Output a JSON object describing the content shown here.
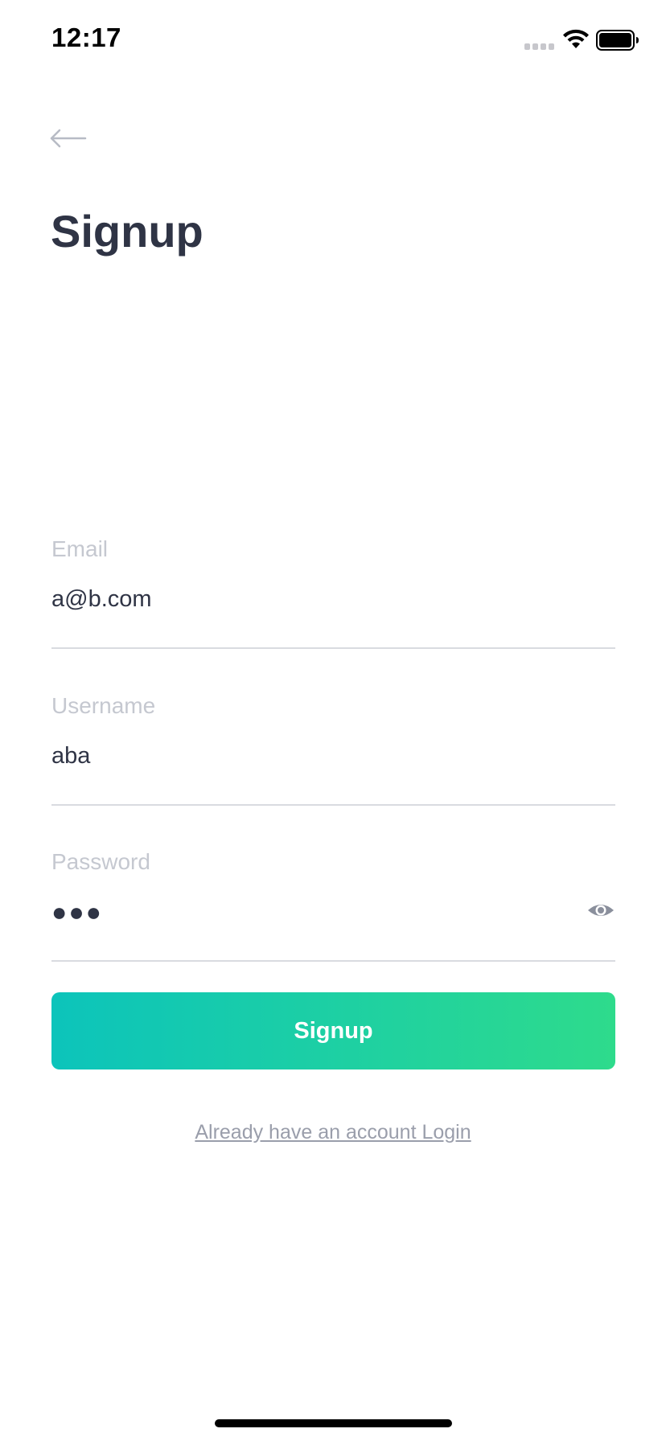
{
  "status_bar": {
    "time": "12:17",
    "icons": [
      "signal-icon",
      "wifi-icon",
      "battery-icon"
    ]
  },
  "header": {
    "back_icon": "back-arrow-icon",
    "title": "Signup"
  },
  "form": {
    "email": {
      "label": "Email",
      "value": "a@b.com"
    },
    "username": {
      "label": "Username",
      "value": "aba"
    },
    "password": {
      "label": "Password",
      "value_masked": "●●●",
      "visibility_icon": "eye-icon"
    }
  },
  "actions": {
    "signup_label": "Signup",
    "login_link": "Already have an account Login"
  },
  "colors": {
    "title_text": "#2f3445",
    "label_text": "#c5c8d0",
    "underline": "#d9dbe0",
    "button_gradient_start": "#0cc4bb",
    "button_gradient_end": "#2edb8c",
    "link_text": "#9a9eab"
  }
}
